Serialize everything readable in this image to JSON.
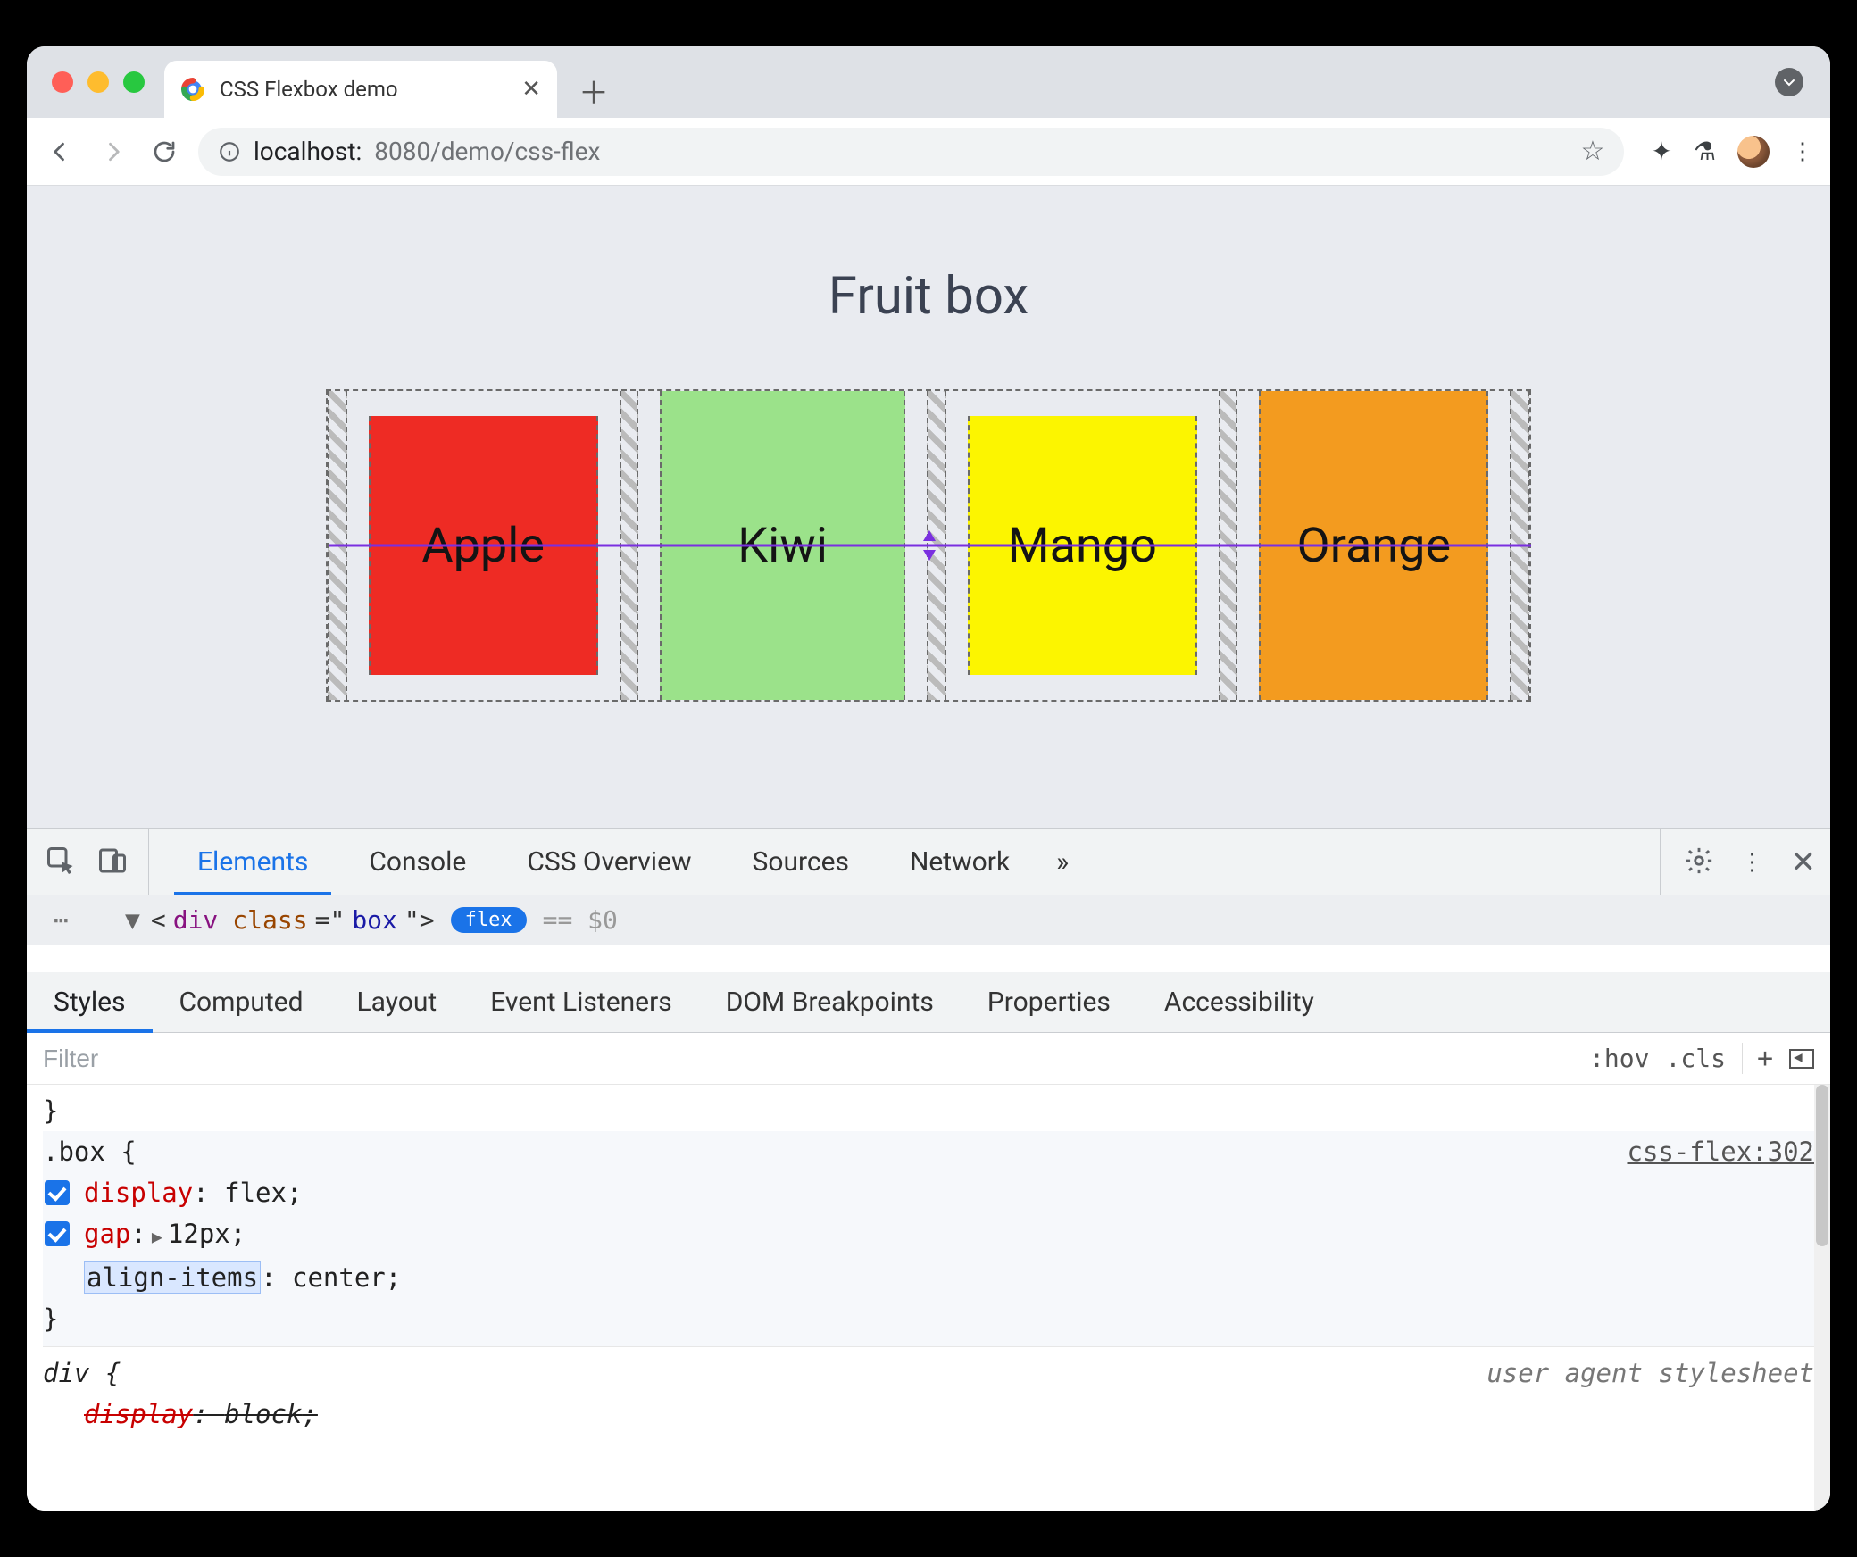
{
  "browser": {
    "tab_title": "CSS Flexbox demo",
    "url_host": "localhost:",
    "url_port_path": "8080/demo/css-flex"
  },
  "page": {
    "title": "Fruit box",
    "fruits": [
      {
        "label": "Apple",
        "cls": "apple"
      },
      {
        "label": "Kiwi",
        "cls": "kiwi"
      },
      {
        "label": "Mango",
        "cls": "mango"
      },
      {
        "label": "Orange",
        "cls": "orange"
      }
    ]
  },
  "devtools": {
    "main_tabs": [
      "Elements",
      "Console",
      "CSS Overview",
      "Sources",
      "Network"
    ],
    "active_main_tab": "Elements",
    "more_tabs_glyph": "»",
    "dom_line": {
      "tag": "div",
      "attr": "class",
      "value": "box",
      "badge": "flex",
      "sel": "== $0"
    },
    "styles_tabs": [
      "Styles",
      "Computed",
      "Layout",
      "Event Listeners",
      "DOM Breakpoints",
      "Properties",
      "Accessibility"
    ],
    "active_styles_tab": "Styles",
    "filter_placeholder": "Filter",
    "hov": ":hov",
    "cls": ".cls",
    "rules": {
      "prev_close": "}",
      "box": {
        "selector": ".box {",
        "source": "css-flex:302",
        "decls": [
          {
            "prop": "display",
            "val": "flex",
            "chk": true
          },
          {
            "prop": "gap",
            "val": "12px",
            "chk": true,
            "expand": true
          }
        ],
        "new_prop": "align-items",
        "new_val": "center",
        "close": "}"
      },
      "ua": {
        "selector": "div {",
        "label": "user agent stylesheet",
        "decl_prop": "display",
        "decl_val": "block"
      }
    }
  }
}
